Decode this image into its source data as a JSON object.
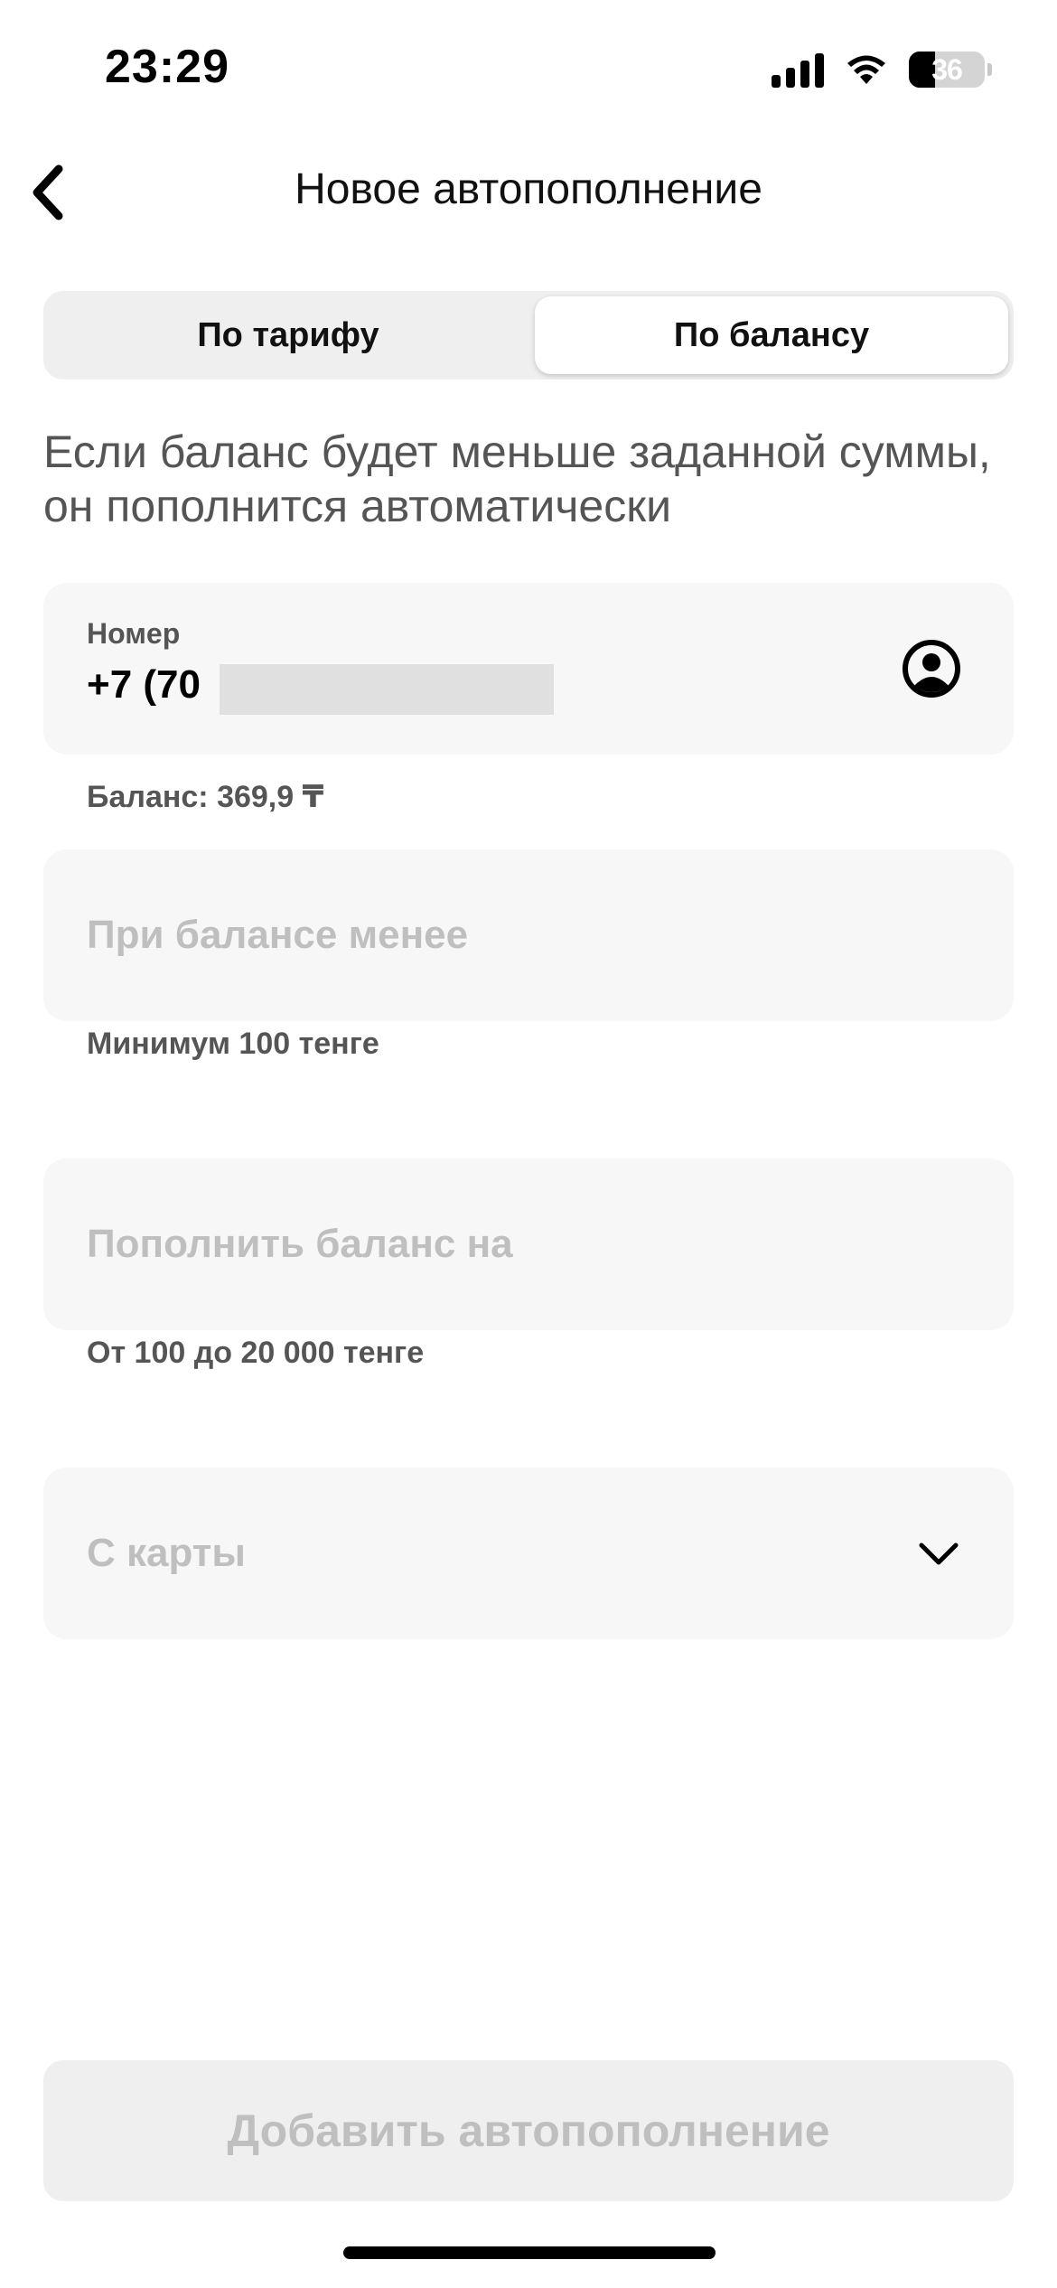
{
  "status_bar": {
    "time": "23:29",
    "battery": "36",
    "icons": [
      "signal-icon",
      "wifi-icon",
      "battery-icon"
    ]
  },
  "nav": {
    "title": "Новое автопополнение",
    "back_icon": "chevron-left-icon"
  },
  "segmented": {
    "tabs": [
      {
        "label": "По тарифу",
        "selected": false
      },
      {
        "label": "По балансу",
        "selected": true
      }
    ]
  },
  "description": "Если баланс будет меньше заданной суммы, он пополнится автоматически",
  "phone": {
    "label": "Номер",
    "value": "+7 (70",
    "balance": "Баланс: 369,9 ₸",
    "contact_icon": "person-circle-icon"
  },
  "min_balance": {
    "placeholder": "При балансе менее",
    "hint": "Минимум 100 тенге"
  },
  "topup_amount": {
    "placeholder": "Пополнить баланс на",
    "hint": "От 100 до 20 000 тенге"
  },
  "card": {
    "placeholder": "С карты",
    "dropdown_icon": "chevron-down-icon"
  },
  "submit": {
    "label": "Добавить автопополнение",
    "enabled": false
  },
  "colors": {
    "background": "#ffffff",
    "field_bg": "#f7f7f7",
    "segment_bg": "#efefef",
    "placeholder": "#bfbfbf",
    "secondary_text": "#555555",
    "disabled_button_bg": "#efefef"
  }
}
